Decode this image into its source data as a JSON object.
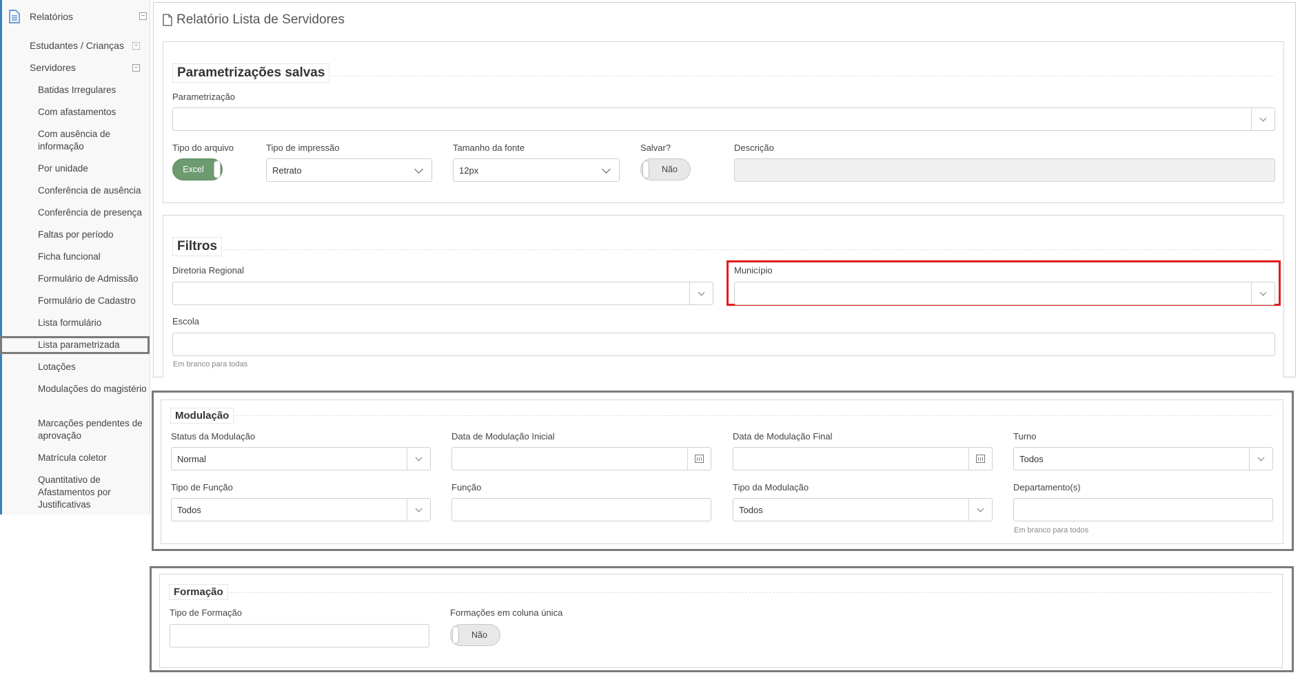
{
  "sidebar": {
    "root_label": "Relatórios",
    "sub1_label": "Estudantes / Crianças",
    "sub2_label": "Servidores",
    "items": [
      "Batidas Irregulares",
      "Com afastamentos",
      "Com ausência de informação",
      "Por unidade",
      "Conferência de ausência",
      "Conferência de presença",
      "Faltas por período",
      "Ficha funcional",
      "Formulário de Admissão",
      "Formulário de Cadastro",
      "Lista formulário",
      "Lista parametrizada",
      "Lotações",
      "Modulações do magistério",
      "Marcações pendentes de aprovação",
      "Matrícula coletor",
      "Quantitativo de Afastamentos por Justificativas"
    ],
    "active_item": "Lista parametrizada",
    "accent_color": "#3a7fc4"
  },
  "page": {
    "title": "Relatório Lista de Servidores"
  },
  "param": {
    "legend": "Parametrizações salvas",
    "parametrizacao_label": "Parametrização",
    "tipo_arquivo_label": "Tipo do arquivo",
    "tipo_arquivo_value": "Excel",
    "tipo_impressao_label": "Tipo de impressão",
    "tipo_impressao_value": "Retrato",
    "tamanho_fonte_label": "Tamanho da fonte",
    "tamanho_fonte_value": "12px",
    "salvar_label": "Salvar?",
    "salvar_value": "Não",
    "descricao_label": "Descrição"
  },
  "filtros": {
    "legend": "Filtros",
    "diretoria_label": "Diretoria Regional",
    "municipio_label": "Município",
    "escola_label": "Escola",
    "escola_hint": "Em branco para todas"
  },
  "modulacao": {
    "legend": "Modulação",
    "status_label": "Status da Modulação",
    "status_value": "Normal",
    "data_inicial_label": "Data de Modulação Inicial",
    "data_final_label": "Data de Modulação Final",
    "turno_label": "Turno",
    "turno_value": "Todos",
    "tipo_funcao_label": "Tipo de Função",
    "tipo_funcao_value": "Todos",
    "funcao_label": "Função",
    "tipo_modulacao_label": "Tipo da Modulação",
    "tipo_modulacao_value": "Todos",
    "departamentos_label": "Departamento(s)",
    "departamentos_hint": "Em branco para todos"
  },
  "formacao": {
    "legend": "Formação",
    "tipo_label": "Tipo de Formação",
    "coluna_unica_label": "Formações em coluna única",
    "coluna_unica_value": "Não"
  },
  "colors": {
    "toggle_on": "#6d9a6e",
    "highlight_red": "#e01b1b",
    "highlight_gray": "#7a7a7a"
  }
}
